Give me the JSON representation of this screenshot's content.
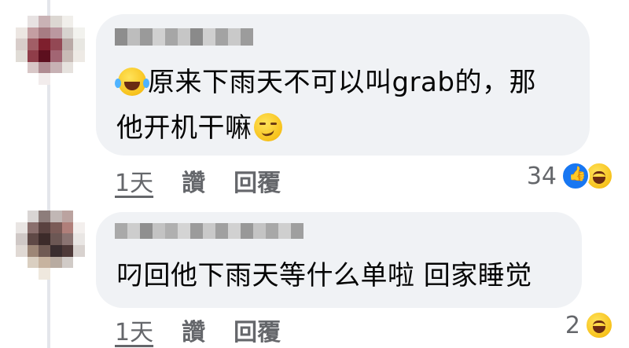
{
  "comments": [
    {
      "text_line1": "原来下雨天不可以叫grab的，那",
      "text_line2": "他开机干嘛",
      "emoji_start": "laughing-tears-emoji",
      "emoji_end": "smirk-emoji",
      "time": "1天",
      "like_label": "讚",
      "reply_label": "回覆",
      "reaction_count": "34",
      "reactions": [
        "like-icon",
        "haha-icon"
      ]
    },
    {
      "text_line1": "叼回他下雨天等什么单啦 回家睡觉",
      "time": "1天",
      "like_label": "讚",
      "reply_label": "回覆",
      "reaction_count": "2",
      "reactions": [
        "haha-icon"
      ]
    }
  ],
  "colors": {
    "bubble": "#f0f2f5",
    "text": "#050505",
    "meta": "#65676b",
    "like": "#1877f2",
    "haha": "#f7c21c"
  }
}
